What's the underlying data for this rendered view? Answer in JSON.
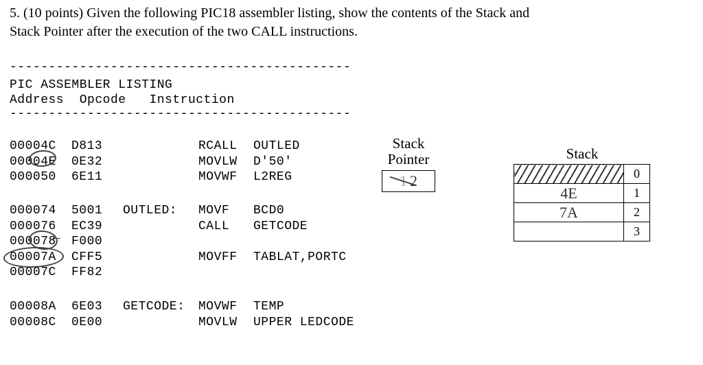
{
  "question": {
    "number": "5.",
    "points": "(10 points)",
    "text_part1": "Given the following PIC18 assembler listing, show the contents of the Stack and",
    "text_part2": "Stack Pointer after the execution of the two CALL instructions."
  },
  "listing": {
    "dashes": "--------------------------------------------",
    "title": "PIC ASSEMBLER LISTING",
    "header_address": "Address",
    "header_opcode": "Opcode",
    "header_instruction": "Instruction"
  },
  "code_block1": [
    {
      "addr": "00004C",
      "op": "D813",
      "label": "",
      "mnemonic": "RCALL",
      "operand": "OUTLED"
    },
    {
      "addr": "00004E",
      "op": "0E32",
      "label": "",
      "mnemonic": "MOVLW",
      "operand": "D'50'"
    },
    {
      "addr": "000050",
      "op": "6E11",
      "label": "",
      "mnemonic": "MOVWF",
      "operand": "L2REG"
    }
  ],
  "code_block2": [
    {
      "addr": "000074",
      "op": "5001",
      "label": "OUTLED:",
      "mnemonic": "MOVF",
      "operand": "BCD0"
    },
    {
      "addr": "000076",
      "op": "EC39",
      "label": "",
      "mnemonic": "CALL",
      "operand": "GETCODE"
    },
    {
      "addr": "000078",
      "op": "F000",
      "label": "",
      "mnemonic": "",
      "operand": ""
    },
    {
      "addr": "00007A",
      "op": "CFF5",
      "label": "",
      "mnemonic": "MOVFF",
      "operand": "TABLAT,PORTC"
    },
    {
      "addr": "00007C",
      "op": "FF82",
      "label": "",
      "mnemonic": "",
      "operand": ""
    }
  ],
  "code_block3": [
    {
      "addr": "00008A",
      "op": "6E03",
      "label": "GETCODE:",
      "mnemonic": "MOVWF",
      "operand": "TEMP"
    },
    {
      "addr": "00008C",
      "op": "0E00",
      "label": "",
      "mnemonic": "MOVLW",
      "operand": "UPPER LEDCODE"
    }
  ],
  "stack_pointer": {
    "label_line1": "Stack",
    "label_line2": "Pointer",
    "value_struck": "1",
    "value": "2"
  },
  "stack": {
    "title": "Stack",
    "rows": [
      {
        "idx": "0",
        "value": "",
        "hatched": true
      },
      {
        "idx": "1",
        "value": "4E",
        "hatched": false
      },
      {
        "idx": "2",
        "value": "7A",
        "hatched": false
      },
      {
        "idx": "3",
        "value": "",
        "hatched": false
      }
    ]
  }
}
